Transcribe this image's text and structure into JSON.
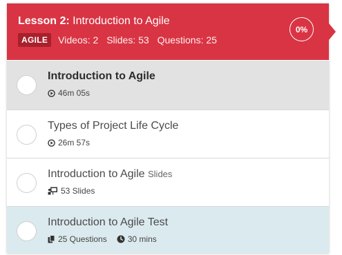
{
  "header": {
    "lesson_number": "Lesson 2:",
    "lesson_title": "Introduction to Agile",
    "badge": "AGILE",
    "videos": "Videos: 2",
    "slides": "Slides: 53",
    "questions": "Questions: 25",
    "progress": "0%",
    "color": "#d93444"
  },
  "items": [
    {
      "title": "Introduction to Agile",
      "meta": "46m 05s",
      "icon": "play-circle-icon",
      "state": "active"
    },
    {
      "title": "Types of Project Life Cycle",
      "meta": "26m 57s",
      "icon": "play-circle-icon"
    },
    {
      "title": "Introduction to Agile",
      "title_suffix": "Slides",
      "meta": "53 Slides",
      "icon": "presentation-icon"
    },
    {
      "title": "Introduction to Agile Test",
      "meta": "25 Questions",
      "meta2": "30 mins",
      "icon": "copy-icon",
      "icon2": "clock-icon",
      "state": "highlighted"
    }
  ]
}
